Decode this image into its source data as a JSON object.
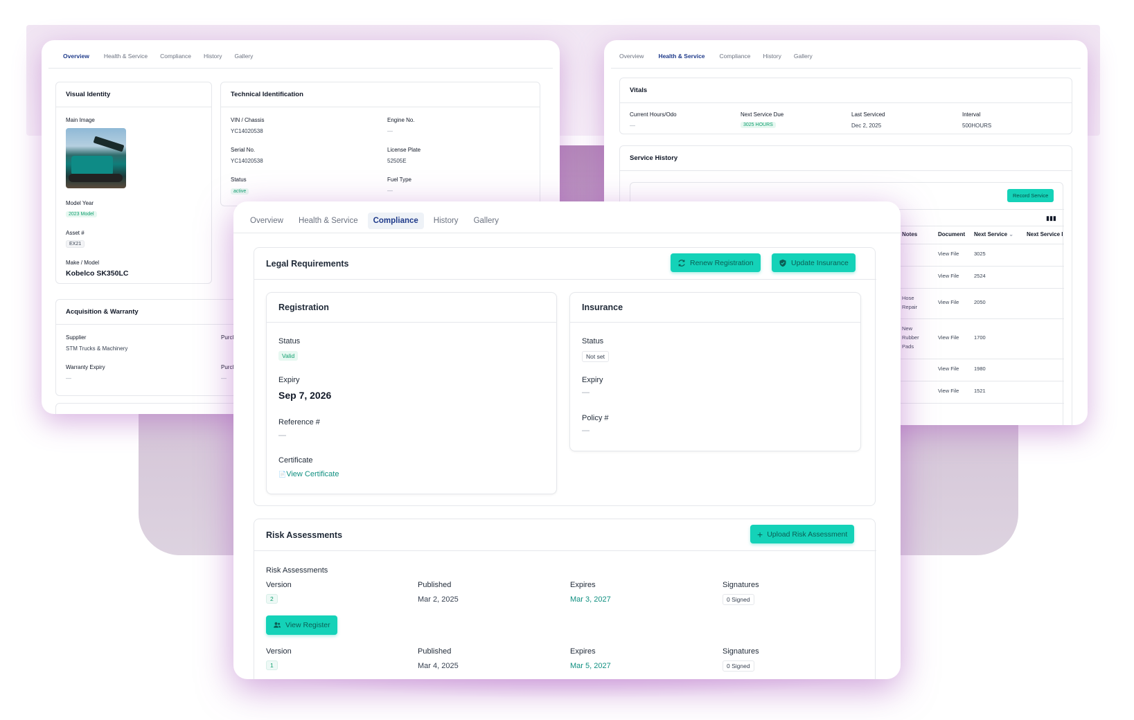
{
  "tabs": [
    "Overview",
    "Health & Service",
    "Compliance",
    "History",
    "Gallery"
  ],
  "left": {
    "active_tab": 0,
    "visual_identity": {
      "title": "Visual Identity",
      "main_image_label": "Main Image",
      "model_year_label": "Model Year",
      "model_year_value": "2023 Model",
      "asset_label": "Asset #",
      "asset_value": "EX21",
      "make_model_label": "Make / Model",
      "make_model_value": "Kobelco SK350LC"
    },
    "technical": {
      "title": "Technical Identification",
      "vin_label": "VIN / Chassis",
      "vin_value": "YC14020538",
      "engine_label": "Engine No.",
      "engine_value": "—",
      "serial_label": "Serial No.",
      "serial_value": "YC14020538",
      "plate_label": "License Plate",
      "plate_value": "52505E",
      "status_label": "Status",
      "status_value": "active",
      "fuel_label": "Fuel Type",
      "fuel_value": "—"
    },
    "acquisition": {
      "title": "Acquisition & Warranty",
      "supplier_label": "Supplier",
      "supplier_value": "STM Trucks & Machinery",
      "purchase_label_1": "Purcha",
      "warranty_label": "Warranty Expiry",
      "warranty_value": "—",
      "purchase_label_2": "Purcha",
      "purchase_value_2": "—"
    }
  },
  "right": {
    "active_tab": 1,
    "vitals": {
      "title": "Vitals",
      "hours_label": "Current Hours/Odo",
      "hours_value": "—",
      "next_label": "Next Service Due",
      "next_value": "3025 HOURS",
      "last_label": "Last Serviced",
      "last_value": "Dec 2, 2025",
      "interval_label": "Interval",
      "interval_value": "500HOURS"
    },
    "service_history": {
      "title": "Service History",
      "record_button": "Record Service",
      "columns_icon": "columns-icon",
      "headers": [
        "Notes",
        "Document",
        "Next Service",
        "Next Service I"
      ],
      "rows": [
        {
          "notes": "",
          "document": "View File",
          "next": "3025"
        },
        {
          "notes": "",
          "document": "View File",
          "next": "2524"
        },
        {
          "notes": "Hose Repair",
          "document": "View File",
          "next": "2050"
        },
        {
          "notes": "New Rubber Pads",
          "document": "View File",
          "next": "1700"
        },
        {
          "notes": "",
          "document": "View File",
          "next": "1980"
        },
        {
          "notes": "",
          "document": "View File",
          "next": "1521"
        }
      ]
    }
  },
  "center": {
    "active_tab": 2,
    "legal": {
      "title": "Legal Requirements",
      "renew_button": "Renew Registration",
      "insurance_button": "Update Insurance",
      "registration": {
        "title": "Registration",
        "status_label": "Status",
        "status_value": "Valid",
        "expiry_label": "Expiry",
        "expiry_value": "Sep 7, 2026",
        "reference_label": "Reference #",
        "reference_value": "—",
        "certificate_label": "Certificate",
        "certificate_link": "View Certificate"
      },
      "insurance": {
        "title": "Insurance",
        "status_label": "Status",
        "status_value": "Not set",
        "expiry_label": "Expiry",
        "expiry_value": "—",
        "policy_label": "Policy #",
        "policy_value": "—"
      }
    },
    "risk": {
      "title": "Risk Assessments",
      "upload_button": "Upload Risk Assessment",
      "subtitle": "Risk Assessments",
      "col_version": "Version",
      "col_published": "Published",
      "col_expires": "Expires",
      "col_signatures": "Signatures",
      "view_register_button": "View Register",
      "items": [
        {
          "version": "2",
          "published": "Mar 2, 2025",
          "expires": "Mar 3, 2027",
          "signatures": "0 Signed"
        },
        {
          "version": "1",
          "published": "Mar 4, 2025",
          "expires": "Mar 5, 2027",
          "signatures": "0 Signed"
        }
      ]
    }
  },
  "colors": {
    "accent_teal": "#14d2b8",
    "active_tab": "#1e3a8a",
    "link_teal": "#0f8f80",
    "glow_purple": "#b488b9"
  }
}
